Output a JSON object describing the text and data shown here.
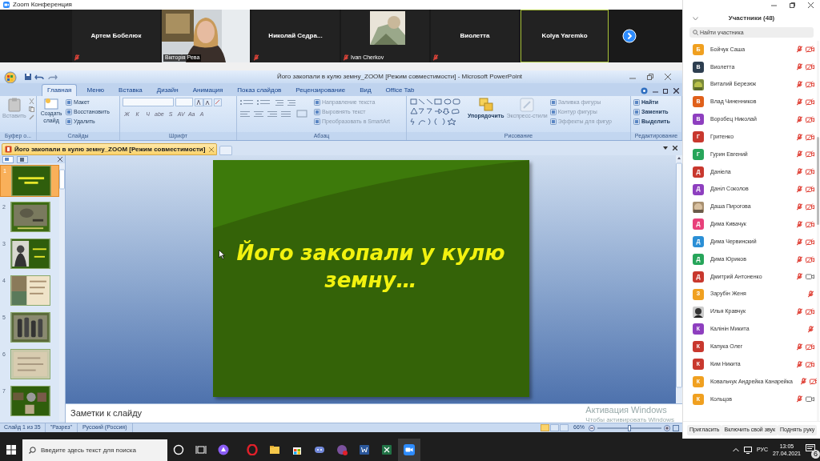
{
  "zoom_window": {
    "title": "Zoom Конференция"
  },
  "video_strip": {
    "tiles": [
      {
        "name": "Артем Бобелюк",
        "kind": "name",
        "muted": true,
        "active": false
      },
      {
        "name": "Вікторія Рева",
        "kind": "video",
        "muted": false,
        "active": false
      },
      {
        "name": "Николай  Седра...",
        "kind": "name",
        "muted": true,
        "active": false
      },
      {
        "name": "Ivan Cherkov",
        "kind": "avatar",
        "muted": true,
        "active": false
      },
      {
        "name": "Виолетта",
        "kind": "name",
        "muted": true,
        "active": false
      },
      {
        "name": "Kolya Yaremko",
        "kind": "name",
        "muted": false,
        "active": true
      }
    ]
  },
  "powerpoint": {
    "title": "Його закопали в кулю земну_ZOOM [Режим совместимости] - Microsoft PowerPoint",
    "tabs": [
      {
        "label": "Главная",
        "selected": true
      },
      {
        "label": "Меню",
        "selected": false
      },
      {
        "label": "Вставка",
        "selected": false
      },
      {
        "label": "Дизайн",
        "selected": false
      },
      {
        "label": "Анимация",
        "selected": false
      },
      {
        "label": "Показ слайдов",
        "selected": false
      },
      {
        "label": "Рецензирование",
        "selected": false
      },
      {
        "label": "Вид",
        "selected": false
      },
      {
        "label": "Office Tab",
        "selected": false
      }
    ],
    "ribbon": {
      "clipboard": {
        "label": "Буфер о...",
        "paste": "Вставить"
      },
      "slides": {
        "label": "Слайды",
        "new_slide": "Создать слайд",
        "items": [
          "Макет",
          "Восстановить",
          "Удалить"
        ]
      },
      "font": {
        "label": "Шрифт",
        "buttons": [
          "Ж",
          "К",
          "Ч",
          "abe",
          "S",
          "AV",
          "Aa",
          "A"
        ]
      },
      "paragraph": {
        "label": "Абзац",
        "items": [
          "Направление текста",
          "Выровнять текст",
          "Преобразовать в SmartArt"
        ]
      },
      "drawing": {
        "label": "Рисование",
        "arrange": "Упорядочить",
        "quick_styles": "Экспресс-стили",
        "items": [
          "Заливка фигуры",
          "Контур фигуры",
          "Эффекты для фигур"
        ]
      },
      "editing": {
        "label": "Редактирование",
        "items": [
          "Найти",
          "Заменить",
          "Выделить"
        ]
      }
    },
    "document_tab": "Його закопали в кулю земну_ZOOM [Режим совместимости]",
    "slides": [
      {
        "number": "1",
        "selected": true
      },
      {
        "number": "2",
        "selected": false
      },
      {
        "number": "3",
        "selected": false
      },
      {
        "number": "4",
        "selected": false
      },
      {
        "number": "5",
        "selected": false
      },
      {
        "number": "6",
        "selected": false
      },
      {
        "number": "7",
        "selected": false
      }
    ],
    "slide": {
      "title": "Його закопали у кулю земну…"
    },
    "notes_placeholder": "Заметки к слайду",
    "status_bar": {
      "slide": "Слайд 1 из 35",
      "theme": "\"Разрез\"",
      "language": "Русский (Россия)",
      "zoom": "66%",
      "level": 0.5
    }
  },
  "windows_activation": {
    "title": "Активация Windows",
    "message": "Чтобы активировать Windows"
  },
  "participants": {
    "title": "Участники (48)",
    "search": {
      "placeholder": "Найти участника"
    },
    "items": [
      {
        "name": "Бойчук Саша",
        "initial": "Б",
        "color": "#f0a020",
        "mic_muted": true,
        "video_off": true
      },
      {
        "name": "Виолетта",
        "initial": "В",
        "color": "#2d3e50",
        "mic_muted": true,
        "video_off": true
      },
      {
        "name": "Виталий Березюк",
        "kind": "picture",
        "mic_muted": true,
        "video_off": true
      },
      {
        "name": "Влад Чиненников",
        "initial": "В",
        "color": "#e0601a",
        "mic_muted": true,
        "video_off": true
      },
      {
        "name": "Воробец Николай",
        "initial": "В",
        "color": "#8e3fbf",
        "mic_muted": true,
        "video_off": true
      },
      {
        "name": "Гритенко",
        "initial": "Г",
        "color": "#c8382e",
        "mic_muted": true,
        "video_off": true
      },
      {
        "name": "Гурин Евгений",
        "initial": "Г",
        "color": "#27a55a",
        "mic_muted": true,
        "video_off": true
      },
      {
        "name": "Даніела",
        "initial": "Д",
        "color": "#c8382e",
        "mic_muted": true,
        "video_off": true
      },
      {
        "name": "Даніл Соколов",
        "initial": "Д",
        "color": "#8e3fbf",
        "mic_muted": true,
        "video_off": true
      },
      {
        "name": "Даша Пирогова",
        "kind": "picture",
        "mic_muted": true,
        "video_off": true
      },
      {
        "name": "Дима Кивачук",
        "initial": "Д",
        "color": "#e8407a",
        "mic_muted": true,
        "video_off": true
      },
      {
        "name": "Дима Червинский",
        "initial": "Д",
        "color": "#2b8fd6",
        "mic_muted": true,
        "video_off": true
      },
      {
        "name": "Дима Юриков",
        "initial": "Д",
        "color": "#27a55a",
        "mic_muted": true,
        "video_off": true
      },
      {
        "name": "Дмитрий Антоненко",
        "initial": "Д",
        "color": "#c8382e",
        "mic_muted": true,
        "video_off": false
      },
      {
        "name": "Зарубін Женя",
        "initial": "З",
        "color": "#f0a020",
        "mic_muted": true
      },
      {
        "name": "Илья Кравчук",
        "kind": "picture",
        "mic_muted": true,
        "video_off": true
      },
      {
        "name": "Калінін Микита",
        "initial": "К",
        "color": "#8e3fbf",
        "mic_muted": true
      },
      {
        "name": "Капука Олег",
        "initial": "К",
        "color": "#c8382e",
        "mic_muted": true,
        "video_off": true
      },
      {
        "name": "Ким Никита",
        "initial": "К",
        "color": "#c8382e",
        "mic_muted": true,
        "video_off": true
      },
      {
        "name": "Ковальчук Андрейка Канарейка",
        "initial": "К",
        "color": "#f0a020",
        "mic_muted": true,
        "video_off": true
      },
      {
        "name": "Кольцов",
        "initial": "К",
        "color": "#f0a020",
        "mic_muted": true,
        "video_off": false
      }
    ],
    "buttons": [
      "Пригласить",
      "Включить свой звук",
      "Поднять руку"
    ]
  },
  "taskbar": {
    "search": {
      "placeholder": "Введите здесь текст для поиска"
    },
    "language": "РУС",
    "time": "13:05",
    "date": "27.04.2021",
    "notifications": "6"
  }
}
